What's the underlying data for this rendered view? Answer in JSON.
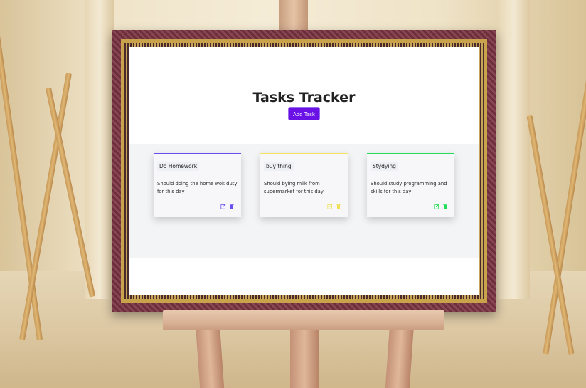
{
  "app": {
    "title": "Tasks Tracker",
    "add_button_label": "Add Task",
    "accent_color": "#6a11e6"
  },
  "tasks": [
    {
      "title": "Do Homework",
      "description": "Should doing the home wok duty for this day",
      "color": "#6a4ff0",
      "edit_icon": "edit-icon",
      "delete_icon": "trash-icon"
    },
    {
      "title": "buy thing",
      "description": "Should bying milk from supermarket for this day",
      "color": "#f3e35a",
      "edit_icon": "edit-icon",
      "delete_icon": "trash-icon"
    },
    {
      "title": "Stydying",
      "description": "Should study programming and skills for this day",
      "color": "#22dd55",
      "edit_icon": "edit-icon",
      "delete_icon": "trash-icon"
    }
  ]
}
